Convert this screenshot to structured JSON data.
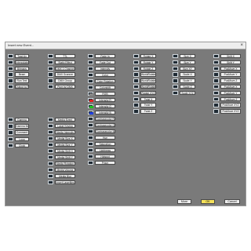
{
  "window": {
    "title": "Insert new Event...",
    "close_glyph": "×"
  },
  "col1": [
    {
      "label": "Toad Ax",
      "icon": "toad-icon"
    },
    {
      "label": "Interpolate",
      "icon": "interpolate-icon"
    },
    {
      "label": "Bitmaps",
      "icon": "bitmap-icon"
    },
    {
      "label": "Beam",
      "icon": "beam-icon"
    },
    {
      "label": "Run Text",
      "icon": "text-icon"
    },
    {
      "label": "Output to Fly",
      "icon": "output-icon"
    }
  ],
  "col1b": [
    {
      "label": "Gamma",
      "icon": "gamma-icon"
    },
    {
      "label": "Gamma Morph",
      "icon": "morph-icon"
    },
    {
      "label": "Comment",
      "icon": "comment-icon"
    },
    {
      "label": "Loop",
      "icon": "loop-icon"
    },
    {
      "label": "Clock",
      "icon": "clock-icon"
    }
  ],
  "col2": [
    {
      "label": "TTL",
      "icon": "ttl-icon"
    },
    {
      "label": "Static Effect",
      "icon": "static-icon"
    },
    {
      "label": "DMX 1 Channel",
      "icon": "dmx-icon"
    },
    {
      "label": "DMX Scanner",
      "icon": "scanner-icon"
    },
    {
      "label": "DMX Group",
      "icon": "group-icon"
    },
    {
      "label": "Pure by DMX",
      "icon": "pure-icon"
    }
  ],
  "col2b": [
    {
      "label": "Media Event",
      "icon": "media-icon"
    },
    {
      "label": "Laser Keying",
      "icon": "laser-icon"
    },
    {
      "label": "Media Intensity",
      "icon": "intensity-icon"
    },
    {
      "label": "Media Size X",
      "icon": "size-icon"
    },
    {
      "label": "Media Size Y",
      "icon": "size-icon"
    },
    {
      "label": "Media Shift X",
      "icon": "shift-icon"
    },
    {
      "label": "Media Shift Y",
      "icon": "shift-icon"
    },
    {
      "label": "Media Rotation",
      "icon": "rotation-icon"
    },
    {
      "label": "Media Volume",
      "icon": "volume-icon"
    },
    {
      "label": "Media Blur",
      "icon": "blur-icon"
    },
    {
      "label": "Insert Laserfiles",
      "icon": "insert-icon"
    }
  ],
  "col3": [
    {
      "label": "Fade In",
      "icon": "fade-in-icon"
    },
    {
      "label": "Fade Out",
      "icon": "fade-out-icon"
    },
    {
      "label": "Intensity",
      "icon": "intensity-icon"
    },
    {
      "label": "Color",
      "icon": "color-icon"
    },
    {
      "label": "Color Rotation",
      "icon": "color-rotation-icon"
    },
    {
      "label": "Colorshift",
      "icon": "colorshift-icon"
    },
    {
      "label": "RGB",
      "icon": "rgb-icon",
      "swatch": "#888888"
    },
    {
      "label": "Intensity R",
      "icon": "red-icon",
      "swatch": "#e02020"
    },
    {
      "label": "Intensity G",
      "icon": "green-icon",
      "swatch": "#20c020"
    },
    {
      "label": "Intensity B",
      "icon": "blue-icon",
      "swatch": "#2040e0"
    },
    {
      "label": "Contrasecolor R",
      "icon": "red-icon"
    },
    {
      "label": "Contrasecolor G",
      "icon": "green-icon"
    },
    {
      "label": "Contrasecolor B",
      "icon": "blue-icon"
    },
    {
      "label": "Hue",
      "icon": "hue-icon"
    },
    {
      "label": "Saturation",
      "icon": "saturation-icon"
    },
    {
      "label": "Lightness",
      "icon": "lightness-icon"
    },
    {
      "label": "Hotspot",
      "icon": "hotspot-icon"
    },
    {
      "label": "Prism",
      "icon": "prism-icon"
    }
  ],
  "col4": [
    {
      "label": "Rotate X"
    },
    {
      "label": "Rotate Y"
    },
    {
      "label": "Rotate Z"
    },
    {
      "label": "WorldRotate X"
    },
    {
      "label": "WorldRotate Y"
    },
    {
      "label": "WorldRotate Z"
    },
    {
      "label": "Rotate XYZ"
    },
    {
      "label": "Twist X"
    },
    {
      "label": "Twist Y"
    },
    {
      "label": "Twist Z"
    }
  ],
  "col5": [
    {
      "label": "Size X"
    },
    {
      "label": "Size Y"
    },
    {
      "label": "Size XY"
    },
    {
      "label": "Scale X"
    },
    {
      "label": "Scale Y"
    },
    {
      "label": "Scale Z"
    },
    {
      "label": "Scale XYZ"
    }
  ],
  "col6": [
    {
      "label": "Shift X"
    },
    {
      "label": "Shift Y"
    },
    {
      "label": "PosMove X"
    },
    {
      "label": "PosMove Y"
    },
    {
      "label": "PosMove Z"
    },
    {
      "label": "PosMove X"
    },
    {
      "label": "PosMove Y"
    },
    {
      "label": "PosMove Z"
    },
    {
      "label": "PosMove XYZ"
    },
    {
      "label": "PosMove XYZ"
    }
  ],
  "buttons": {
    "more": "More",
    "ok": "OK",
    "cancel": "Cancel"
  },
  "colors": {
    "ok_bg": "#f6e25a",
    "dialog_bg": "#7a7a7a"
  }
}
